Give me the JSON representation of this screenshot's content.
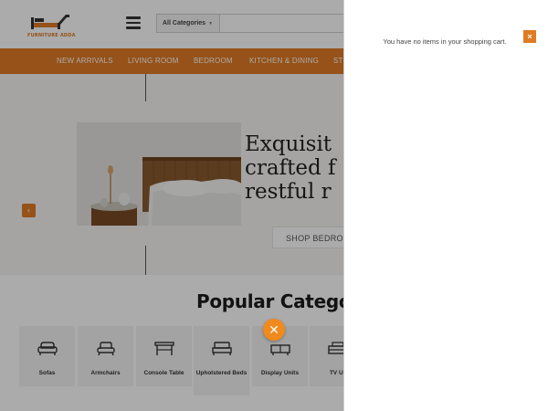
{
  "header": {
    "logo_text": "FURNITURE ADDA",
    "category_select": "All Categories",
    "search_placeholder": ""
  },
  "nav": {
    "items": [
      {
        "label": "NEW ARRIVALS"
      },
      {
        "label": "LIVING ROOM"
      },
      {
        "label": "BEDROOM"
      },
      {
        "label": "KITCHEN & DINING"
      },
      {
        "label": "ST"
      }
    ]
  },
  "hero": {
    "title_lines": [
      "Exquisit",
      "crafted f",
      "restful r"
    ],
    "button_label": "SHOP BEDRO",
    "prev_icon": "‹"
  },
  "popular": {
    "title": "Popular Categor",
    "categories": [
      {
        "label": "Sofas",
        "icon": "sofa-icon"
      },
      {
        "label": "Armchairs",
        "icon": "armchair-icon"
      },
      {
        "label": "Console Table",
        "icon": "console-table-icon"
      },
      {
        "label": "Upholstered Beds",
        "icon": "bed-icon"
      },
      {
        "label": "Display Units",
        "icon": "display-unit-icon"
      },
      {
        "label": "TV Ur",
        "icon": "tv-unit-icon"
      }
    ]
  },
  "close_icon": "✕",
  "cart": {
    "empty_message": "You have no items in your shopping cart.",
    "close_icon": "×"
  },
  "colors": {
    "accent": "#e07b24",
    "overlay": "rgba(0,0,0,0.33)"
  }
}
